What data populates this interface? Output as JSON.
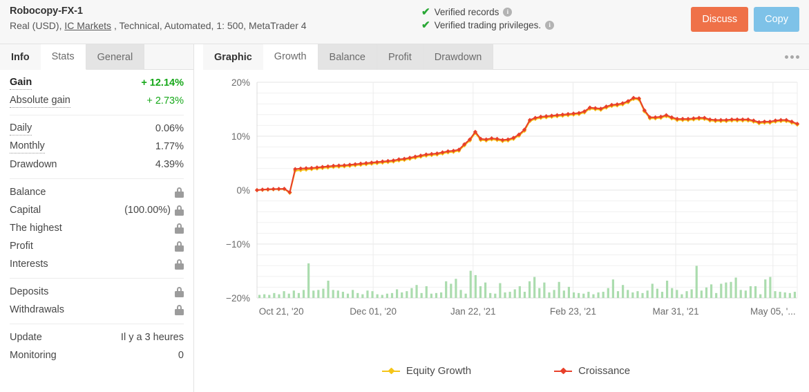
{
  "header": {
    "account_name": "Robocopy-FX-1",
    "account_sub_pre": "Real (USD),",
    "broker_link": "IC Markets",
    "account_sub_post": ", Technical, Automated, 1: 500, MetaTrader 4",
    "verified_records": "Verified records",
    "verified_privileges": "Verified trading privileges.",
    "info_glyph": "i",
    "check_glyph": "✔",
    "discuss_label": "Discuss",
    "copy_label": "Copy",
    "discuss_color": "#ef7148",
    "copy_color": "#7ec2e8",
    "check_color": "#2aa836"
  },
  "sidebar": {
    "tabs": [
      {
        "label": "Info",
        "state": "plain"
      },
      {
        "label": "Stats",
        "state": "active"
      },
      {
        "label": "General",
        "state": "inactive"
      }
    ],
    "groups": [
      {
        "rows": [
          {
            "label": "Gain",
            "value": "+ 12.14%",
            "style": "green",
            "label_style": "bold dotted",
            "lock": false
          },
          {
            "label": "Absolute gain",
            "value": "+ 2.73%",
            "style": "green-light",
            "label_style": "dotted",
            "lock": false
          }
        ]
      },
      {
        "rows": [
          {
            "label": "Daily",
            "value": "0.06%",
            "style": "",
            "label_style": "dotted",
            "lock": false
          },
          {
            "label": "Monthly",
            "value": "1.77%",
            "style": "",
            "label_style": "dotted",
            "lock": false
          },
          {
            "label": "Drawdown",
            "value": "4.39%",
            "style": "",
            "label_style": "",
            "lock": false
          }
        ]
      },
      {
        "rows": [
          {
            "label": "Balance",
            "value": "",
            "style": "",
            "label_style": "",
            "lock": true
          },
          {
            "label": "Capital",
            "value": "(100.00%)",
            "style": "",
            "label_style": "",
            "lock": true
          },
          {
            "label": "The highest",
            "value": "",
            "style": "",
            "label_style": "",
            "lock": true
          },
          {
            "label": "Profit",
            "value": "",
            "style": "",
            "label_style": "",
            "lock": true
          },
          {
            "label": "Interests",
            "value": "",
            "style": "",
            "label_style": "",
            "lock": true
          }
        ]
      },
      {
        "rows": [
          {
            "label": "Deposits",
            "value": "",
            "style": "",
            "label_style": "",
            "lock": true
          },
          {
            "label": "Withdrawals",
            "value": "",
            "style": "",
            "label_style": "",
            "lock": true
          }
        ]
      },
      {
        "rows": [
          {
            "label": "Update",
            "value": "Il y a 3 heures",
            "style": "",
            "label_style": "",
            "lock": false
          },
          {
            "label": "Monitoring",
            "value": "0",
            "style": "",
            "label_style": "",
            "lock": false
          }
        ]
      }
    ]
  },
  "main": {
    "tabs": [
      {
        "label": "Graphic",
        "state": "plain"
      },
      {
        "label": "Growth",
        "state": "active"
      },
      {
        "label": "Balance",
        "state": "inactive"
      },
      {
        "label": "Profit",
        "state": "inactive"
      },
      {
        "label": "Drawdown",
        "state": "inactive"
      }
    ],
    "menu_label": "more-options"
  },
  "chart_data": {
    "type": "line",
    "title": "",
    "xlabel": "",
    "ylabel": "",
    "ylim": [
      -20,
      20
    ],
    "ytick_labels": [
      "20%",
      "10%",
      "0%",
      "−10%",
      "−20%"
    ],
    "ytick_values": [
      20,
      10,
      0,
      -10,
      -20
    ],
    "minor_gridline_step": 2,
    "grid": true,
    "legend_position": "bottom",
    "xtick_labels": [
      "Oct 21, '20",
      "Dec 01, '20",
      "Jan 22, '21",
      "Feb 23, '21",
      "Mar 31, '21",
      "May 05, '..."
    ],
    "xtick_positions": [
      0.045,
      0.215,
      0.4,
      0.585,
      0.775,
      0.955
    ],
    "colors": {
      "croissance": "#e8402a",
      "equity": "#f5c518",
      "bars": "#abdcae"
    },
    "series": [
      {
        "name": "Equity Growth",
        "color": "#f5c518",
        "values": [
          0.0,
          0.05,
          0.1,
          0.15,
          0.18,
          0.2,
          -0.5,
          3.6,
          3.7,
          3.8,
          3.9,
          4.0,
          4.1,
          4.2,
          4.3,
          4.35,
          4.4,
          4.5,
          4.6,
          4.7,
          4.8,
          4.9,
          5.0,
          5.1,
          5.2,
          5.3,
          5.5,
          5.6,
          5.8,
          6.0,
          6.2,
          6.4,
          6.5,
          6.6,
          6.8,
          7.0,
          7.1,
          7.3,
          8.3,
          9.2,
          10.6,
          9.3,
          9.2,
          9.4,
          9.3,
          9.1,
          9.2,
          9.5,
          10.1,
          11.0,
          12.8,
          13.2,
          13.4,
          13.5,
          13.6,
          13.7,
          13.8,
          13.9,
          14.0,
          14.1,
          14.4,
          15.1,
          15.0,
          14.9,
          15.3,
          15.6,
          15.7,
          15.9,
          16.3,
          16.9,
          16.8,
          14.6,
          13.3,
          13.3,
          13.4,
          13.7,
          13.3,
          13.0,
          13.0,
          13.0,
          13.1,
          13.2,
          13.2,
          12.9,
          12.8,
          12.8,
          12.8,
          12.9,
          12.9,
          12.9,
          12.9,
          12.7,
          12.4,
          12.5,
          12.5,
          12.7,
          12.8,
          12.8,
          12.5,
          12.14
        ]
      },
      {
        "name": "Croissance",
        "color": "#e8402a",
        "values": [
          0.0,
          0.1,
          0.15,
          0.2,
          0.22,
          0.25,
          -0.4,
          3.9,
          4.0,
          4.05,
          4.1,
          4.2,
          4.3,
          4.4,
          4.5,
          4.55,
          4.6,
          4.7,
          4.8,
          4.9,
          5.0,
          5.1,
          5.2,
          5.3,
          5.4,
          5.5,
          5.7,
          5.8,
          6.0,
          6.2,
          6.4,
          6.6,
          6.7,
          6.8,
          7.0,
          7.2,
          7.3,
          7.5,
          8.5,
          9.4,
          10.8,
          9.5,
          9.4,
          9.6,
          9.5,
          9.3,
          9.4,
          9.7,
          10.3,
          11.2,
          13.0,
          13.4,
          13.6,
          13.7,
          13.8,
          13.9,
          14.0,
          14.1,
          14.2,
          14.3,
          14.6,
          15.3,
          15.2,
          15.1,
          15.5,
          15.8,
          15.9,
          16.1,
          16.5,
          17.1,
          17.0,
          14.8,
          13.5,
          13.5,
          13.6,
          13.9,
          13.5,
          13.2,
          13.2,
          13.2,
          13.3,
          13.4,
          13.4,
          13.1,
          13.0,
          13.0,
          13.0,
          13.1,
          13.1,
          13.1,
          13.1,
          12.9,
          12.6,
          12.7,
          12.7,
          12.9,
          13.0,
          13.0,
          12.7,
          12.3
        ]
      }
    ],
    "bars": {
      "name": "volume",
      "color": "#abdcae",
      "baseline": -20,
      "max_height_pct": 7.5,
      "values": [
        0.5,
        0.6,
        0.5,
        0.8,
        0.6,
        1.1,
        0.7,
        1.2,
        0.8,
        1.3,
        5.6,
        1.2,
        1.3,
        1.5,
        2.8,
        1.3,
        1.2,
        1.0,
        0.7,
        1.3,
        0.8,
        0.6,
        1.2,
        1.1,
        0.6,
        0.5,
        0.7,
        0.8,
        1.4,
        0.9,
        1.1,
        1.6,
        2.1,
        0.8,
        1.9,
        0.7,
        0.8,
        0.9,
        2.7,
        2.3,
        3.1,
        1.3,
        0.7,
        4.4,
        3.7,
        1.9,
        2.5,
        0.8,
        0.7,
        2.4,
        0.9,
        1.0,
        1.4,
        1.9,
        1.0,
        2.7,
        3.4,
        1.6,
        2.5,
        0.9,
        1.3,
        2.6,
        1.2,
        1.8,
        0.9,
        0.8,
        0.7,
        1.0,
        0.6,
        0.9,
        1.0,
        1.6,
        3.0,
        1.1,
        2.1,
        1.3,
        0.9,
        1.1,
        0.8,
        1.2,
        2.3,
        1.5,
        1.0,
        2.8,
        1.6,
        1.3,
        0.6,
        1.1,
        1.4,
        5.2,
        1.2,
        1.7,
        2.2,
        0.8,
        2.3,
        2.5,
        2.6,
        3.3,
        1.3,
        1.2,
        1.9,
        1.9,
        0.6,
        3.0,
        3.4,
        1.1,
        1.0,
        0.9,
        0.8,
        1.0
      ]
    },
    "legend": [
      {
        "label": "Equity Growth",
        "color": "#f5c518"
      },
      {
        "label": "Croissance",
        "color": "#e8402a"
      }
    ]
  }
}
